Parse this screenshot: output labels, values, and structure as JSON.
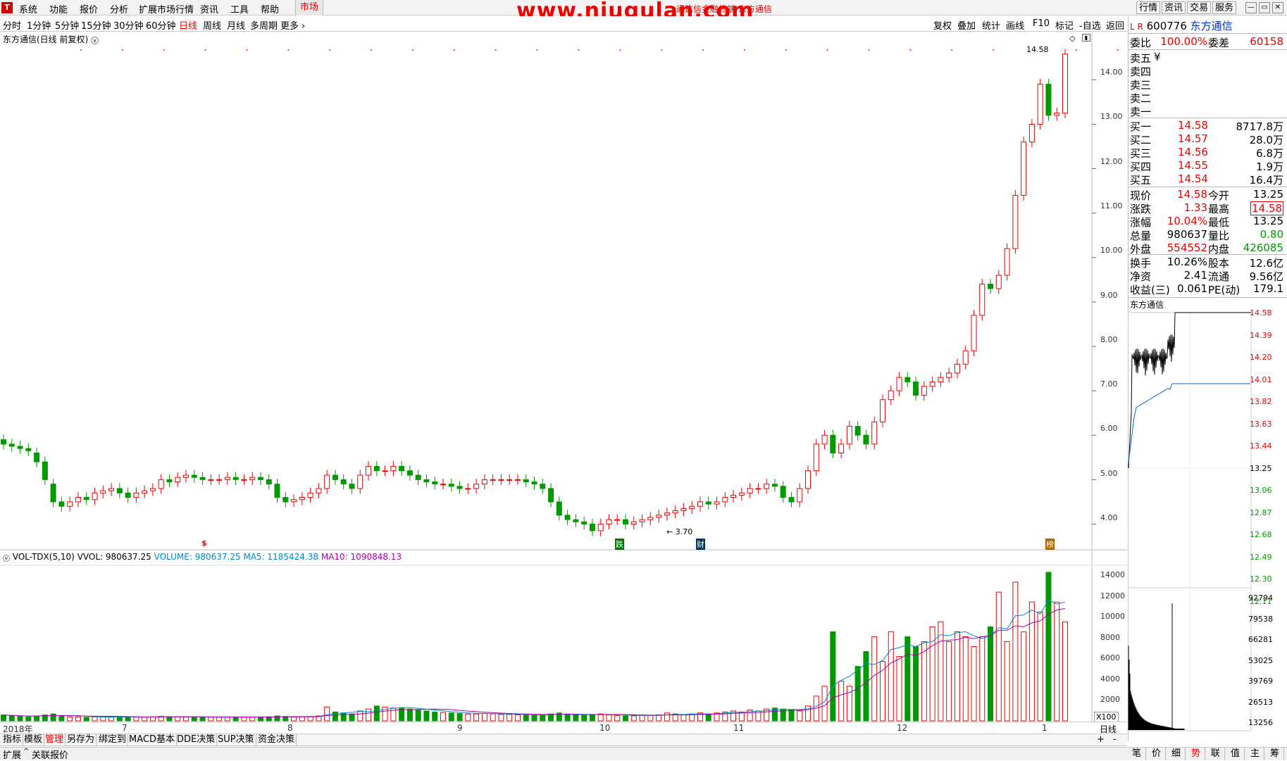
{
  "menubar": {
    "logo": "T",
    "items": [
      "系统",
      "功能",
      "报价",
      "分析",
      "扩展市场行情",
      "资讯",
      "工具",
      "帮助"
    ],
    "market_tab": "市场",
    "watermark": "www.niugulan.com",
    "window_title": "通达信金融终端 东方通信",
    "right_buttons": [
      "行情",
      "资讯",
      "交易",
      "服务"
    ],
    "window_controls": [
      "—",
      "▭",
      "✕"
    ]
  },
  "periods": {
    "items": [
      "分时",
      "1分钟",
      "5分钟",
      "15分钟",
      "30分钟",
      "60分钟",
      "日线",
      "周线",
      "月线",
      "多周期",
      "更多"
    ],
    "active": "日线"
  },
  "tools": [
    "复权",
    "叠加",
    "统计",
    "画线",
    "F10",
    "标记",
    "-自选",
    "返回"
  ],
  "chart": {
    "title": "东方通信(日线 前复权)",
    "price_ticks": [
      "14.00",
      "13.00",
      "12.00",
      "11.00",
      "10.00",
      "9.00",
      "8.00",
      "7.00",
      "6.00",
      "5.00",
      "4.00"
    ],
    "high_label": "14.58",
    "low_label": "3.70",
    "markers": [
      "$",
      "跌",
      "财",
      "榜"
    ],
    "indicator_title": "VOL-TDX(5,10)",
    "vvol_text": "VVOL: 980637.25",
    "volume_text": "VOLUME: 980637.25",
    "ma5_text": "MA5: 1185424.38",
    "ma10_text": "MA10: 1090848.13",
    "vol_ticks": [
      "14000",
      "12000",
      "10000",
      "8000",
      "6000",
      "4000",
      "2000"
    ],
    "vol_unit": "X100",
    "dates": [
      "2018年",
      "7",
      "8",
      "9",
      "10",
      "11",
      "12",
      "1"
    ],
    "period_label": "日线"
  },
  "chart_data": {
    "type": "candlestick",
    "title": "东方通信(日线 前复权)",
    "ylim": [
      3.5,
      14.75
    ],
    "vol_ylim": [
      0,
      15000
    ],
    "candles_approx": {
      "open": [
        5.9,
        5.8,
        5.75,
        5.7,
        5.6,
        5.4,
        4.9,
        4.5,
        4.4,
        4.5,
        4.6,
        4.55,
        4.7,
        4.75,
        4.8,
        4.7,
        4.6,
        4.7,
        4.75,
        4.8,
        5.0,
        4.95,
        5.05,
        5.1,
        5.05,
        5.0,
        5.0,
        5.0,
        5.05,
        5.0,
        5.0,
        5.05,
        5.0,
        4.9,
        4.6,
        4.5,
        4.55,
        4.6,
        4.7,
        4.8,
        5.1,
        5.0,
        4.9,
        4.8,
        5.1,
        5.3,
        5.2,
        5.2,
        5.3,
        5.2,
        5.1,
        5.0,
        4.95,
        4.9,
        4.9,
        4.85,
        4.8,
        4.8,
        4.9,
        5.0,
        5.0,
        5.0,
        5.0,
        5.0,
        4.95,
        4.9,
        4.8,
        4.5,
        4.2,
        4.1,
        4.05,
        4.0,
        3.85,
        4.0,
        4.1,
        4.1,
        4.0,
        4.05,
        4.1,
        4.15,
        4.2,
        4.25,
        4.3,
        4.35,
        4.4,
        4.5,
        4.45,
        4.5,
        4.6,
        4.65,
        4.7,
        4.8,
        4.8,
        4.9,
        4.85,
        4.6,
        4.5,
        4.8,
        5.2,
        5.8,
        6.0,
        5.6,
        5.8,
        6.2,
        6.0,
        5.8,
        6.3,
        6.8,
        7.0,
        7.3,
        7.2,
        6.9,
        7.1,
        7.2,
        7.3,
        7.4,
        7.6,
        7.9,
        8.7,
        9.4,
        9.3,
        9.6,
        10.2,
        11.4,
        12.6,
        13.0,
        13.9,
        13.2,
        13.25
      ],
      "close": [
        5.8,
        5.75,
        5.7,
        5.65,
        5.4,
        5.0,
        4.5,
        4.4,
        4.5,
        4.6,
        4.55,
        4.7,
        4.75,
        4.8,
        4.7,
        4.6,
        4.7,
        4.75,
        4.8,
        5.0,
        4.95,
        5.05,
        5.1,
        5.05,
        5.0,
        5.0,
        5.0,
        5.05,
        5.0,
        5.0,
        5.05,
        5.0,
        4.9,
        4.6,
        4.5,
        4.55,
        4.6,
        4.7,
        4.8,
        5.1,
        5.0,
        4.9,
        4.8,
        5.1,
        5.3,
        5.2,
        5.2,
        5.3,
        5.2,
        5.1,
        5.0,
        4.95,
        4.9,
        4.9,
        4.85,
        4.8,
        4.8,
        4.9,
        5.0,
        5.0,
        5.0,
        5.0,
        5.0,
        4.95,
        4.9,
        4.8,
        4.5,
        4.2,
        4.1,
        4.05,
        4.0,
        3.85,
        4.0,
        4.1,
        4.1,
        4.0,
        4.05,
        4.1,
        4.15,
        4.2,
        4.25,
        4.3,
        4.35,
        4.4,
        4.5,
        4.45,
        4.5,
        4.6,
        4.65,
        4.7,
        4.8,
        4.8,
        4.9,
        4.85,
        4.6,
        4.5,
        4.8,
        5.2,
        5.8,
        6.0,
        5.6,
        5.8,
        6.2,
        6.0,
        5.8,
        6.3,
        6.8,
        7.0,
        7.3,
        7.2,
        6.9,
        7.1,
        7.2,
        7.3,
        7.4,
        7.6,
        7.9,
        8.7,
        9.4,
        9.3,
        9.6,
        10.2,
        11.4,
        12.6,
        13.0,
        13.9,
        13.2,
        13.25,
        14.58
      ]
    },
    "volume_approx": [
      600,
      500,
      450,
      400,
      500,
      600,
      700,
      500,
      400,
      400,
      350,
      400,
      400,
      380,
      400,
      420,
      400,
      380,
      400,
      450,
      430,
      420,
      400,
      380,
      380,
      370,
      380,
      400,
      380,
      370,
      380,
      400,
      420,
      500,
      450,
      400,
      420,
      450,
      500,
      1400,
      900,
      800,
      700,
      1000,
      1200,
      1500,
      1400,
      1300,
      1300,
      1200,
      1100,
      1000,
      900,
      850,
      800,
      750,
      700,
      700,
      750,
      700,
      650,
      650,
      600,
      600,
      550,
      600,
      700,
      800,
      700,
      600,
      550,
      600,
      700,
      600,
      550,
      500,
      500,
      600,
      550,
      600,
      800,
      700,
      600,
      700,
      800,
      700,
      800,
      900,
      1000,
      900,
      1100,
      1000,
      1200,
      1300,
      1200,
      1100,
      1000,
      1500,
      2500,
      3500,
      9000,
      4000,
      3500,
      5500,
      7000,
      8500,
      6000,
      9000,
      6500,
      8500,
      7500,
      8000,
      9500,
      10000,
      8000,
      9000,
      8500,
      7500,
      8500,
      9500,
      13000,
      8000,
      14000,
      9000,
      12000,
      11000,
      15000,
      12000,
      10000
    ]
  },
  "quote": {
    "flags": "L R",
    "code": "600776",
    "name": "东方通信",
    "weibi_label": "委比",
    "weibi": "100.00%",
    "weicha_label": "委差",
    "weicha": "60158",
    "sells": [
      {
        "label": "卖五",
        "price": "¥",
        "vol": ""
      },
      {
        "label": "卖四",
        "price": "",
        "vol": ""
      },
      {
        "label": "卖三",
        "price": "",
        "vol": ""
      },
      {
        "label": "卖二",
        "price": "",
        "vol": ""
      },
      {
        "label": "卖一",
        "price": "",
        "vol": ""
      }
    ],
    "buys": [
      {
        "label": "买一",
        "price": "14.58",
        "vol": "8717.8万"
      },
      {
        "label": "买二",
        "price": "14.57",
        "vol": "28.0万"
      },
      {
        "label": "买三",
        "price": "14.56",
        "vol": "6.8万"
      },
      {
        "label": "买四",
        "price": "14.55",
        "vol": "1.9万"
      },
      {
        "label": "买五",
        "price": "14.54",
        "vol": "16.4万"
      }
    ],
    "stats": [
      {
        "l1": "现价",
        "v1": "14.58",
        "l2": "今开",
        "v2": "13.25",
        "c2": "black"
      },
      {
        "l1": "涨跌",
        "v1": "1.33",
        "l2": "最高",
        "v2": "14.58",
        "c2": "red-box"
      },
      {
        "l1": "涨幅",
        "v1": "10.04%",
        "l2": "最低",
        "v2": "13.25",
        "c2": "black"
      },
      {
        "l1": "总量",
        "v1": "980637",
        "l2": "量比",
        "v2": "0.80",
        "c2": "green",
        "c1": "black"
      },
      {
        "l1": "外盘",
        "v1": "554552",
        "l2": "内盘",
        "v2": "426085",
        "c2": "green"
      }
    ],
    "stats2": [
      {
        "l1": "换手",
        "v1": "10.26%",
        "l2": "股本",
        "v2": "12.6亿"
      },
      {
        "l1": "净资",
        "v1": "2.41",
        "l2": "流通",
        "v2": "9.56亿"
      },
      {
        "l1": "收益(三)",
        "v1": "0.061",
        "l2": "PE(动)",
        "v2": "179.1"
      }
    ],
    "mini_title": "东方通信",
    "mini_price_ticks": [
      "14.58",
      "14.39",
      "14.20",
      "14.01",
      "13.82",
      "13.63",
      "13.44",
      "13.25",
      "13.06",
      "12.87",
      "12.68",
      "12.49",
      "12.30",
      "12.11"
    ],
    "mini_vol_ticks": [
      "92794",
      "79538",
      "66281",
      "53025",
      "39769",
      "26513",
      "13256"
    ],
    "tabs": [
      "笔",
      "价",
      "细",
      "势",
      "联",
      "值",
      "主",
      "筹"
    ],
    "active_tab": "势"
  },
  "bottom_tabs": [
    "指标",
    "模板",
    "管理",
    "另存为",
    "绑定到",
    "MACD基本",
    "DDE决策",
    "SUP决策",
    "资金决策"
  ],
  "bottom_active": "管理",
  "status": [
    "扩展",
    "关联报价"
  ]
}
